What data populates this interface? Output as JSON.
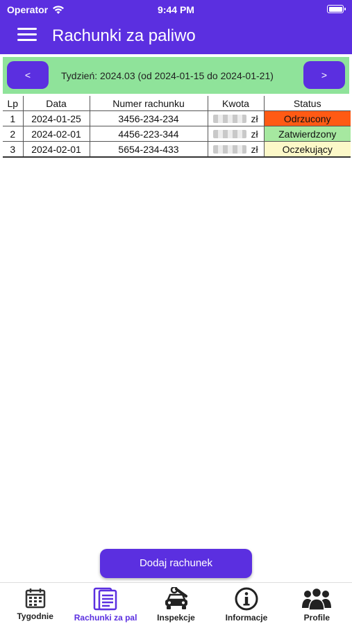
{
  "status_bar": {
    "carrier": "Operator",
    "time": "9:44 PM"
  },
  "header": {
    "title": "Rachunki za paliwo",
    "menu_icon": "hamburger-menu-icon"
  },
  "week": {
    "prev_label": "<",
    "next_label": ">",
    "text": "Tydzień: 2024.03 (od 2024-01-15 do 2024-01-21)"
  },
  "table": {
    "columns": [
      "Lp",
      "Data",
      "Numer rachunku",
      "Kwota",
      "Status"
    ],
    "rows": [
      {
        "lp": "1",
        "date": "2024-01-25",
        "number": "3456-234-234",
        "currency": "zł",
        "status": "Odrzucony",
        "status_color": "#ff5a14"
      },
      {
        "lp": "2",
        "date": "2024-02-01",
        "number": "4456-223-344",
        "currency": "zł",
        "status": "Zatwierdzony",
        "status_color": "#a6e8a0"
      },
      {
        "lp": "3",
        "date": "2024-02-01",
        "number": "5654-234-433",
        "currency": "zł",
        "status": "Oczekujący",
        "status_color": "#fcf8c8"
      }
    ]
  },
  "add_button": {
    "label": "Dodaj rachunek"
  },
  "tabs": [
    {
      "label": "Tygodnie",
      "icon": "calendar-icon",
      "active": false
    },
    {
      "label": "Rachunki za pal",
      "icon": "document-icon",
      "active": true
    },
    {
      "label": "Inspekcje",
      "icon": "car-wrench-icon",
      "active": false
    },
    {
      "label": "Informacje",
      "icon": "info-icon",
      "active": false
    },
    {
      "label": "Profile",
      "icon": "people-icon",
      "active": false
    }
  ],
  "colors": {
    "accent": "#5b2fe0",
    "week_bar": "#8fe39a"
  }
}
